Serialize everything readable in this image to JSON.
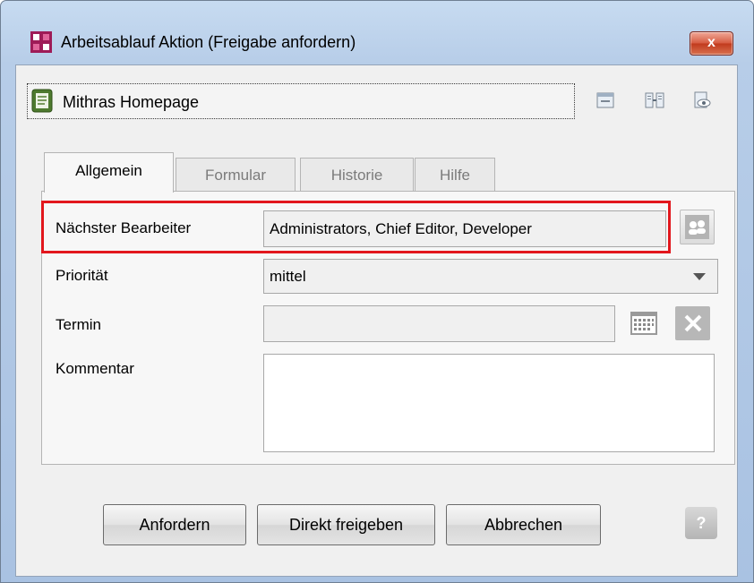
{
  "window": {
    "title": "Arbeitsablauf Aktion (Freigabe anfordern)",
    "close_label": "x"
  },
  "object": {
    "name": "Mithras Homepage"
  },
  "tabs": [
    {
      "label": "Allgemein",
      "active": true
    },
    {
      "label": "Formular",
      "active": false
    },
    {
      "label": "Historie",
      "active": false
    },
    {
      "label": "Hilfe",
      "active": false
    }
  ],
  "form": {
    "next_editor": {
      "label": "Nächster Bearbeiter",
      "value": "Administrators, Chief Editor, Developer"
    },
    "priority": {
      "label": "Priorität",
      "value": "mittel"
    },
    "deadline": {
      "label": "Termin",
      "value": ""
    },
    "comment": {
      "label": "Kommentar",
      "value": ""
    }
  },
  "buttons": {
    "request": "Anfordern",
    "release_direct": "Direkt freigeben",
    "cancel": "Abbrechen",
    "help": "?"
  },
  "colors": {
    "highlight": "#e2171d",
    "title_bar": "#b9cfe9",
    "close_button": "#c8472b"
  },
  "icons": [
    "app-icon",
    "page-icon",
    "preview-icon",
    "compare-icon",
    "view-icon",
    "users-icon",
    "dropdown-arrow-icon",
    "calendar-icon",
    "clear-icon",
    "help-icon"
  ]
}
